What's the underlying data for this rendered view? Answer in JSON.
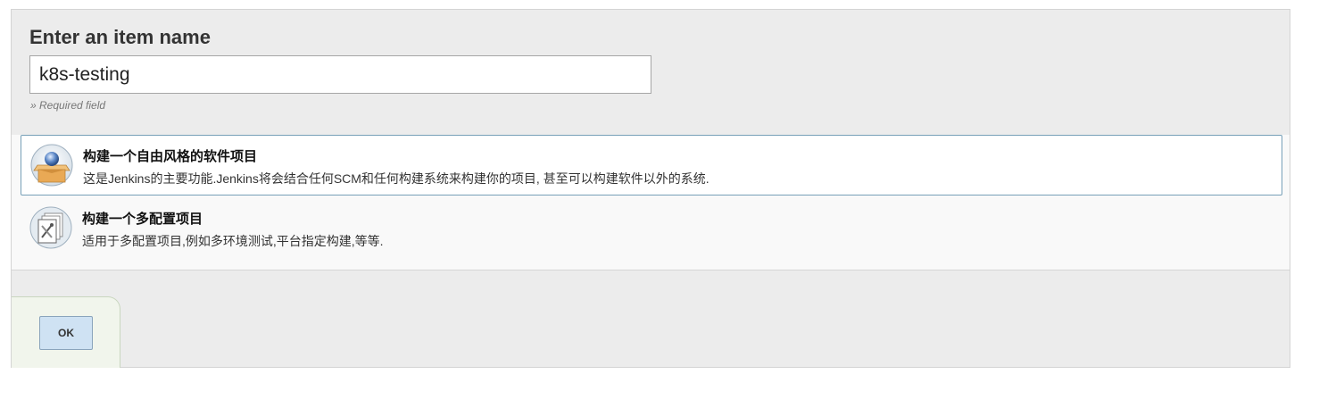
{
  "form": {
    "heading": "Enter an item name",
    "item_name_value": "k8s-testing",
    "required_note": "» Required field"
  },
  "item_types": [
    {
      "icon": "freestyle-project-icon",
      "title": "构建一个自由风格的软件项目",
      "description": "这是Jenkins的主要功能.Jenkins将会结合任何SCM和任何构建系统来构建你的项目, 甚至可以构建软件以外的系统.",
      "selected": true
    },
    {
      "icon": "multi-configuration-project-icon",
      "title": "构建一个多配置项目",
      "description": "适用于多配置项目,例如多环境测试,平台指定构建,等等.",
      "selected": false
    }
  ],
  "actions": {
    "ok_label": "OK"
  },
  "colors": {
    "panel_bg": "#ececec",
    "selected_border": "#77a0b8",
    "ok_button_bg": "#cfe2f3",
    "footer_bg": "#f1f5ec"
  }
}
